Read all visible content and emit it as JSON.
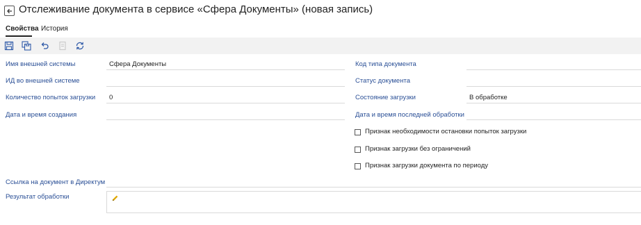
{
  "header": {
    "title": "Отслеживание документа в сервисе «Сфера Документы» (новая запись)"
  },
  "tabs": [
    {
      "label": "Свойства"
    },
    {
      "label": "История"
    }
  ],
  "fields": {
    "external_system_name": {
      "label": "Имя внешней системы",
      "value": "Сфера Документы"
    },
    "external_id": {
      "label": "ИД во внешней системе",
      "value": ""
    },
    "load_attempts": {
      "label": "Количество попыток загрузки",
      "value": "0"
    },
    "created_at": {
      "label": "Дата и время создания",
      "value": ""
    },
    "doc_type_code": {
      "label": "Код типа документа",
      "value": ""
    },
    "doc_status": {
      "label": "Статус документа",
      "value": ""
    },
    "load_state": {
      "label": "Состояние загрузки",
      "value": "В обработке"
    },
    "last_processed_at": {
      "label": "Дата и время последней обработки",
      "value": ""
    },
    "directum_link": {
      "label": "Ссылка на документ в Директум",
      "value": ""
    },
    "processing_result": {
      "label": "Результат обработки",
      "value": ""
    }
  },
  "checkboxes": [
    {
      "label": "Признак необходимости остановки попыток загрузки",
      "checked": false
    },
    {
      "label": "Признак загрузки без ограничений",
      "checked": false
    },
    {
      "label": "Признак загрузки документа по периоду",
      "checked": false
    }
  ],
  "colors": {
    "label": "#2a4f96",
    "toolbar_icon": "#2f5aa8",
    "toolbar_bg": "#f2f2f2",
    "pencil": "#e0a800"
  }
}
